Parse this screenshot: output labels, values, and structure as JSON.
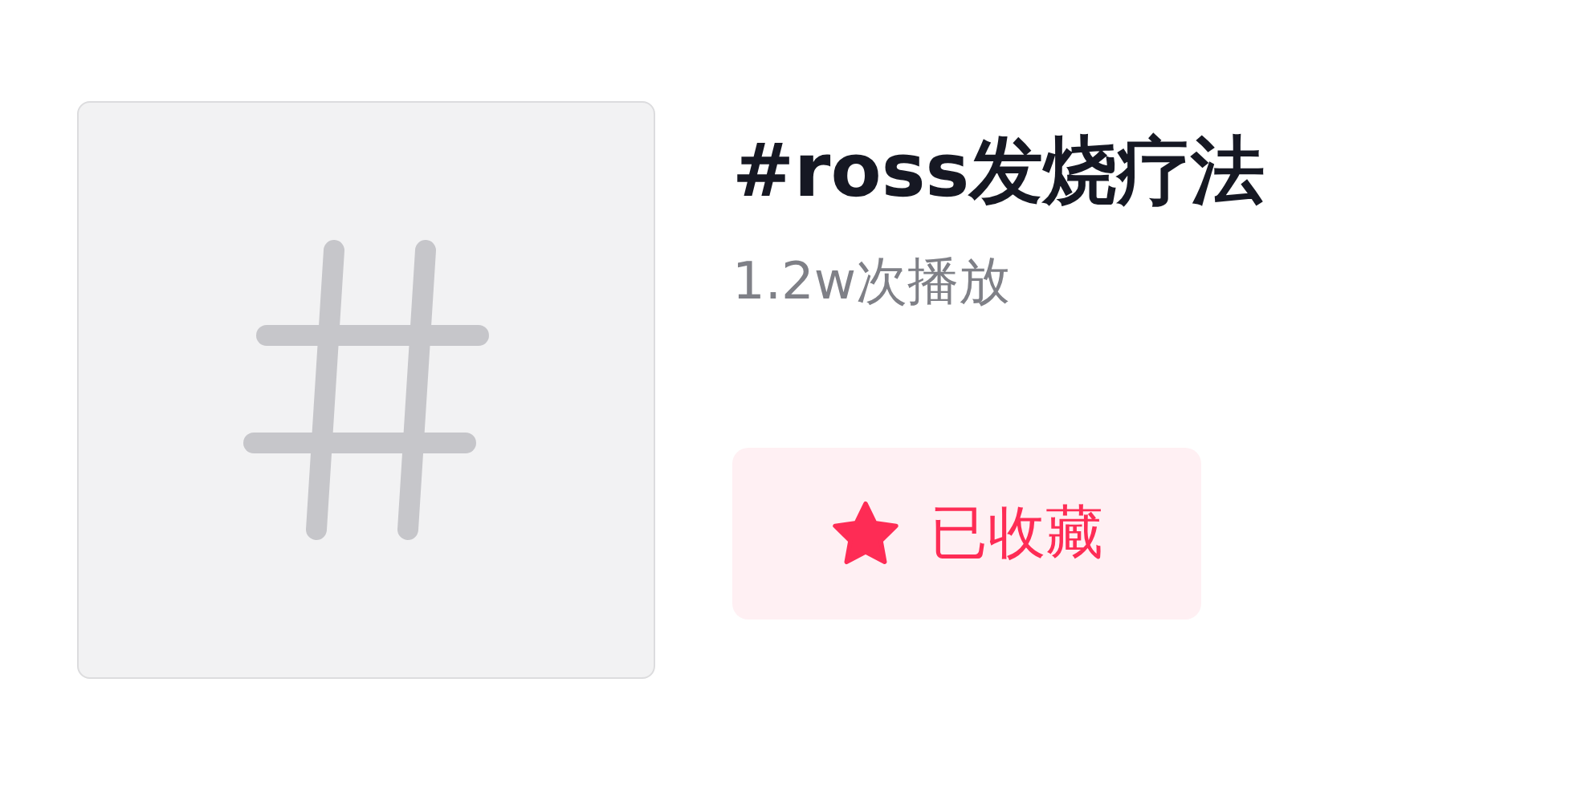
{
  "title": "#ross发烧疗法",
  "play_count": "1.2w次播放",
  "favorite_button": {
    "label": "已收藏",
    "selected": true
  }
}
